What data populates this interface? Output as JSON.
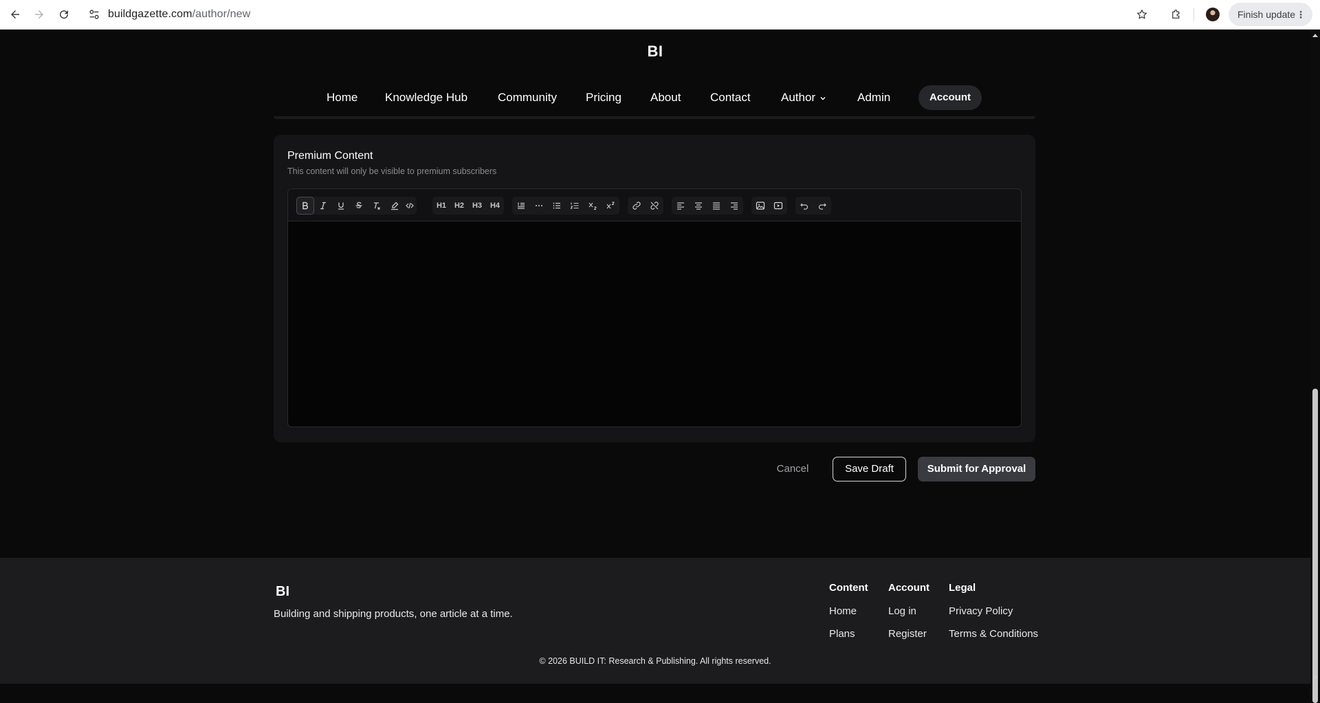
{
  "browser": {
    "url_domain": "buildgazette.com",
    "url_path": "/author/new",
    "finish_update_label": "Finish update",
    "menu_dots": "⋮"
  },
  "site": {
    "logo": "BI",
    "nav": [
      {
        "label": "Home"
      },
      {
        "label": "Knowledge Hub"
      },
      {
        "label": "Community"
      },
      {
        "label": "Pricing"
      },
      {
        "label": "About"
      },
      {
        "label": "Contact"
      },
      {
        "label": "Author"
      },
      {
        "label": "Admin"
      }
    ],
    "account_label": "Account"
  },
  "premium": {
    "title": "Premium Content",
    "subtitle": "This content will only be visible to premium subscribers",
    "toolbar": {
      "h1": "H1",
      "h2": "H2",
      "h3": "H3",
      "h4": "H4"
    }
  },
  "actions": {
    "cancel": "Cancel",
    "save_draft": "Save Draft",
    "submit": "Submit for Approval"
  },
  "footer": {
    "logo": "BI",
    "tagline": "Building and shipping products, one article at a time.",
    "columns": [
      {
        "title": "Content",
        "links": [
          "Home",
          "Plans"
        ]
      },
      {
        "title": "Account",
        "links": [
          "Log in",
          "Register"
        ]
      },
      {
        "title": "Legal",
        "links": [
          "Privacy Policy",
          "Terms & Conditions"
        ]
      }
    ],
    "copyright": "© 2026 BUILD IT: Research & Publishing. All rights reserved."
  }
}
